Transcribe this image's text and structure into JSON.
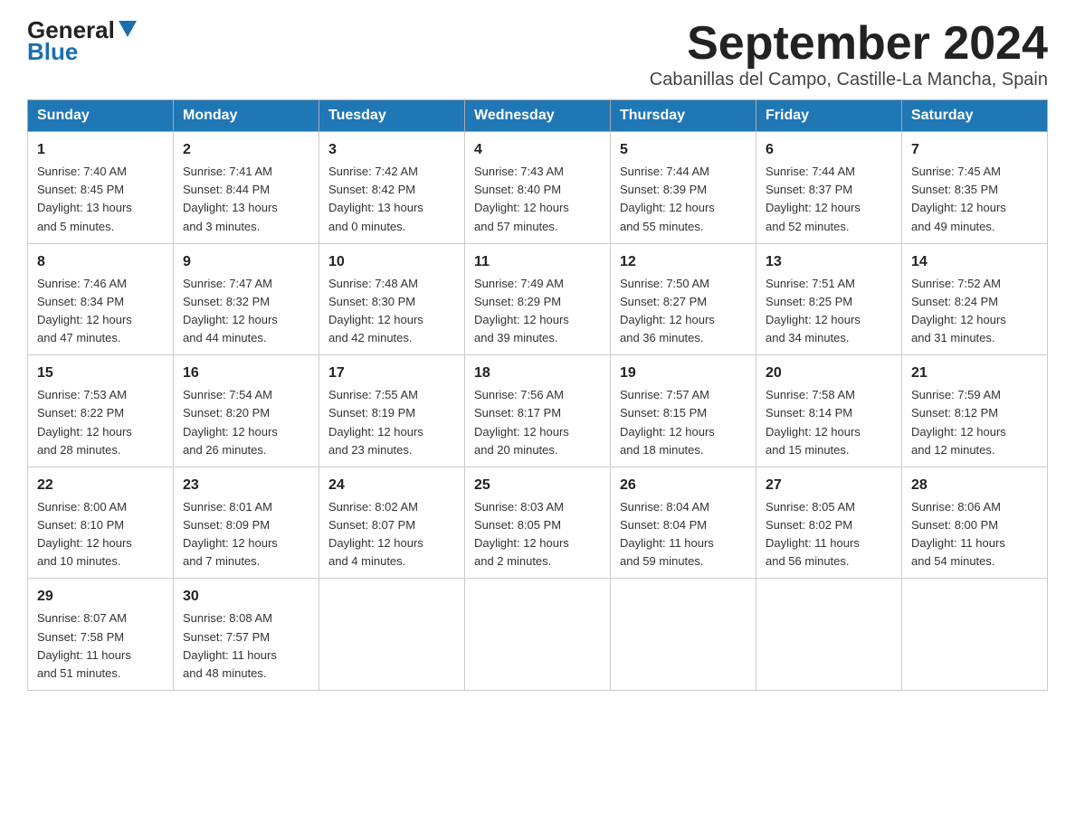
{
  "logo": {
    "general": "General",
    "blue": "Blue"
  },
  "header": {
    "month_year": "September 2024",
    "location": "Cabanillas del Campo, Castille-La Mancha, Spain"
  },
  "weekdays": [
    "Sunday",
    "Monday",
    "Tuesday",
    "Wednesday",
    "Thursday",
    "Friday",
    "Saturday"
  ],
  "weeks": [
    [
      {
        "day": "1",
        "sunrise": "7:40 AM",
        "sunset": "8:45 PM",
        "daylight": "13 hours and 5 minutes."
      },
      {
        "day": "2",
        "sunrise": "7:41 AM",
        "sunset": "8:44 PM",
        "daylight": "13 hours and 3 minutes."
      },
      {
        "day": "3",
        "sunrise": "7:42 AM",
        "sunset": "8:42 PM",
        "daylight": "13 hours and 0 minutes."
      },
      {
        "day": "4",
        "sunrise": "7:43 AM",
        "sunset": "8:40 PM",
        "daylight": "12 hours and 57 minutes."
      },
      {
        "day": "5",
        "sunrise": "7:44 AM",
        "sunset": "8:39 PM",
        "daylight": "12 hours and 55 minutes."
      },
      {
        "day": "6",
        "sunrise": "7:44 AM",
        "sunset": "8:37 PM",
        "daylight": "12 hours and 52 minutes."
      },
      {
        "day": "7",
        "sunrise": "7:45 AM",
        "sunset": "8:35 PM",
        "daylight": "12 hours and 49 minutes."
      }
    ],
    [
      {
        "day": "8",
        "sunrise": "7:46 AM",
        "sunset": "8:34 PM",
        "daylight": "12 hours and 47 minutes."
      },
      {
        "day": "9",
        "sunrise": "7:47 AM",
        "sunset": "8:32 PM",
        "daylight": "12 hours and 44 minutes."
      },
      {
        "day": "10",
        "sunrise": "7:48 AM",
        "sunset": "8:30 PM",
        "daylight": "12 hours and 42 minutes."
      },
      {
        "day": "11",
        "sunrise": "7:49 AM",
        "sunset": "8:29 PM",
        "daylight": "12 hours and 39 minutes."
      },
      {
        "day": "12",
        "sunrise": "7:50 AM",
        "sunset": "8:27 PM",
        "daylight": "12 hours and 36 minutes."
      },
      {
        "day": "13",
        "sunrise": "7:51 AM",
        "sunset": "8:25 PM",
        "daylight": "12 hours and 34 minutes."
      },
      {
        "day": "14",
        "sunrise": "7:52 AM",
        "sunset": "8:24 PM",
        "daylight": "12 hours and 31 minutes."
      }
    ],
    [
      {
        "day": "15",
        "sunrise": "7:53 AM",
        "sunset": "8:22 PM",
        "daylight": "12 hours and 28 minutes."
      },
      {
        "day": "16",
        "sunrise": "7:54 AM",
        "sunset": "8:20 PM",
        "daylight": "12 hours and 26 minutes."
      },
      {
        "day": "17",
        "sunrise": "7:55 AM",
        "sunset": "8:19 PM",
        "daylight": "12 hours and 23 minutes."
      },
      {
        "day": "18",
        "sunrise": "7:56 AM",
        "sunset": "8:17 PM",
        "daylight": "12 hours and 20 minutes."
      },
      {
        "day": "19",
        "sunrise": "7:57 AM",
        "sunset": "8:15 PM",
        "daylight": "12 hours and 18 minutes."
      },
      {
        "day": "20",
        "sunrise": "7:58 AM",
        "sunset": "8:14 PM",
        "daylight": "12 hours and 15 minutes."
      },
      {
        "day": "21",
        "sunrise": "7:59 AM",
        "sunset": "8:12 PM",
        "daylight": "12 hours and 12 minutes."
      }
    ],
    [
      {
        "day": "22",
        "sunrise": "8:00 AM",
        "sunset": "8:10 PM",
        "daylight": "12 hours and 10 minutes."
      },
      {
        "day": "23",
        "sunrise": "8:01 AM",
        "sunset": "8:09 PM",
        "daylight": "12 hours and 7 minutes."
      },
      {
        "day": "24",
        "sunrise": "8:02 AM",
        "sunset": "8:07 PM",
        "daylight": "12 hours and 4 minutes."
      },
      {
        "day": "25",
        "sunrise": "8:03 AM",
        "sunset": "8:05 PM",
        "daylight": "12 hours and 2 minutes."
      },
      {
        "day": "26",
        "sunrise": "8:04 AM",
        "sunset": "8:04 PM",
        "daylight": "11 hours and 59 minutes."
      },
      {
        "day": "27",
        "sunrise": "8:05 AM",
        "sunset": "8:02 PM",
        "daylight": "11 hours and 56 minutes."
      },
      {
        "day": "28",
        "sunrise": "8:06 AM",
        "sunset": "8:00 PM",
        "daylight": "11 hours and 54 minutes."
      }
    ],
    [
      {
        "day": "29",
        "sunrise": "8:07 AM",
        "sunset": "7:58 PM",
        "daylight": "11 hours and 51 minutes."
      },
      {
        "day": "30",
        "sunrise": "8:08 AM",
        "sunset": "7:57 PM",
        "daylight": "11 hours and 48 minutes."
      },
      null,
      null,
      null,
      null,
      null
    ]
  ],
  "labels": {
    "sunrise": "Sunrise:",
    "sunset": "Sunset:",
    "daylight": "Daylight:"
  }
}
